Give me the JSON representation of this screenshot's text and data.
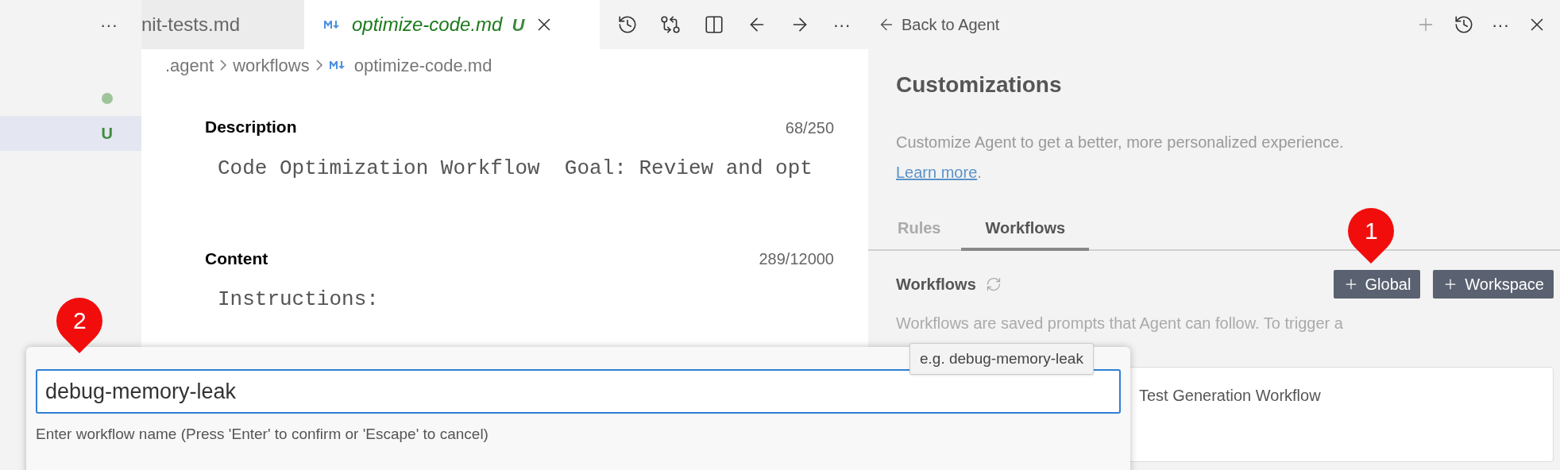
{
  "sidebar": {
    "more": "···",
    "items": [
      {
        "kind": "dot",
        "selected": false,
        "color": "#9ec49a"
      },
      {
        "kind": "letter",
        "text": "U",
        "selected": true
      }
    ]
  },
  "tabs": [
    {
      "label": "nit-tests.md",
      "selected": false
    },
    {
      "label": "optimize-code.md",
      "selected": true,
      "status": "U"
    }
  ],
  "editor_toolbar": {
    "more": "···"
  },
  "breadcrumb": [
    ".agent",
    "workflows",
    "optimize-code.md"
  ],
  "fields": [
    {
      "label": "Description",
      "counter": "68/250",
      "lines": [
        "Code Optimization Workflow  Goal: Review and opt"
      ]
    },
    {
      "label": "Content",
      "counter": "289/12000",
      "lines": [
        "Instructions:"
      ]
    }
  ],
  "panel": {
    "back": "Back to Agent",
    "more": "···",
    "title": "Customizations",
    "description": "Customize Agent to get a better, more personalized experience.",
    "link": "Learn more",
    "link_suffix": ".",
    "tabs": [
      {
        "label": "Rules",
        "selected": false
      },
      {
        "label": "Workflows",
        "selected": true
      }
    ],
    "section_title": "Workflows",
    "buttons": [
      "Global",
      "Workspace"
    ],
    "section_description": "Workflows are saved prompts that Agent can follow. To trigger a",
    "card_title": "Test Generation Workflow"
  },
  "tooltip": "e.g. debug-memory-leak",
  "quick_input": {
    "value": "debug-memory-leak",
    "hint": "Enter workflow name (Press 'Enter' to confirm or 'Escape' to cancel)"
  },
  "callouts": [
    "1",
    "2"
  ]
}
